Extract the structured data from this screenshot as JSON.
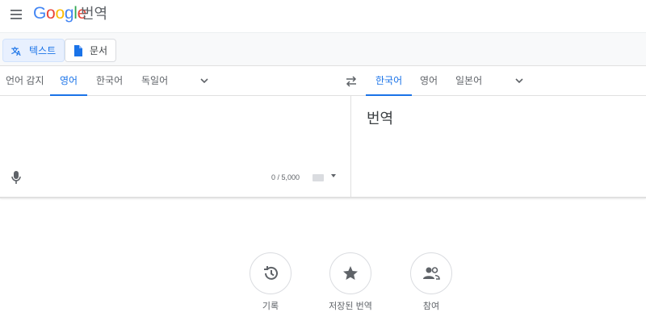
{
  "header": {
    "logo_letters": [
      "G",
      "o",
      "o",
      "g",
      "l",
      "e"
    ],
    "product": "번역",
    "icons": [
      "menu-icon"
    ]
  },
  "modes": [
    {
      "label": "텍스트",
      "icon": "translate-icon",
      "active": true
    },
    {
      "label": "문서",
      "icon": "document-icon",
      "active": false
    }
  ],
  "source_langs": [
    {
      "label": "언어 감지",
      "active": false
    },
    {
      "label": "영어",
      "active": true
    },
    {
      "label": "한국어",
      "active": false
    },
    {
      "label": "독일어",
      "active": false
    }
  ],
  "target_langs": [
    {
      "label": "한국어",
      "active": true
    },
    {
      "label": "영어",
      "active": false
    },
    {
      "label": "일본어",
      "active": false
    }
  ],
  "input": {
    "counter": "0 / 5,000"
  },
  "output": {
    "text": "번역"
  },
  "actions": [
    {
      "label": "기록",
      "icon": "history-icon"
    },
    {
      "label": "저장된 번역",
      "icon": "star-icon"
    },
    {
      "label": "참여",
      "icon": "people-icon"
    }
  ],
  "colors": {
    "accent": "#1a73e8",
    "logo": [
      "#4285F4",
      "#EA4335",
      "#FBBC05",
      "#4285F4",
      "#34A853",
      "#EA4335"
    ]
  }
}
